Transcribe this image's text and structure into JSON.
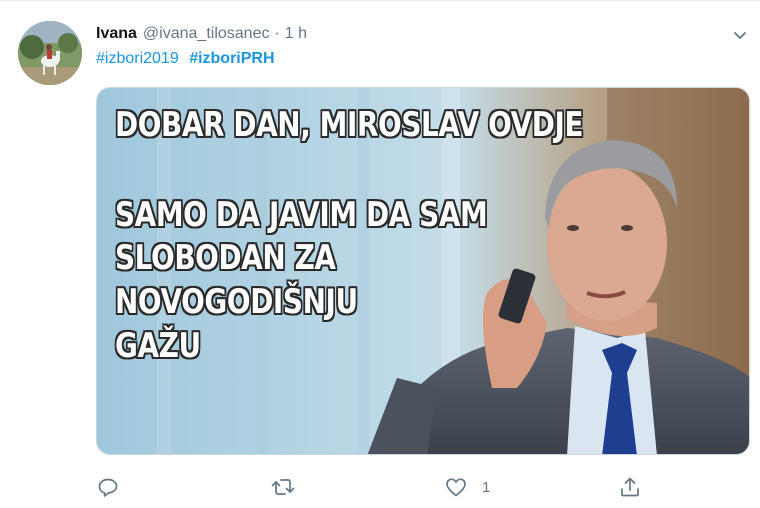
{
  "tweet": {
    "author_name": "Ivana",
    "author_handle": "@ivana_tilosanec",
    "separator": "·",
    "timestamp": "1 h",
    "hashtags": [
      "#izbori2019",
      "#izboriPRH"
    ],
    "media": {
      "lines": [
        "DOBAR DAN, MIROSLAV OVDJE",
        "SAMO DA JAVIM DA SAM",
        "SLOBODAN ZA",
        "NOVOGODIŠNJU",
        "GAŽU"
      ]
    },
    "actions": {
      "like_count": "1"
    }
  },
  "icons": {
    "menu": "chevron-down-icon",
    "reply": "reply-icon",
    "retweet": "retweet-icon",
    "like": "heart-icon",
    "share": "share-icon"
  },
  "colors": {
    "link": "#1b95e0",
    "name": "#14171a",
    "secondary": "#657786"
  }
}
